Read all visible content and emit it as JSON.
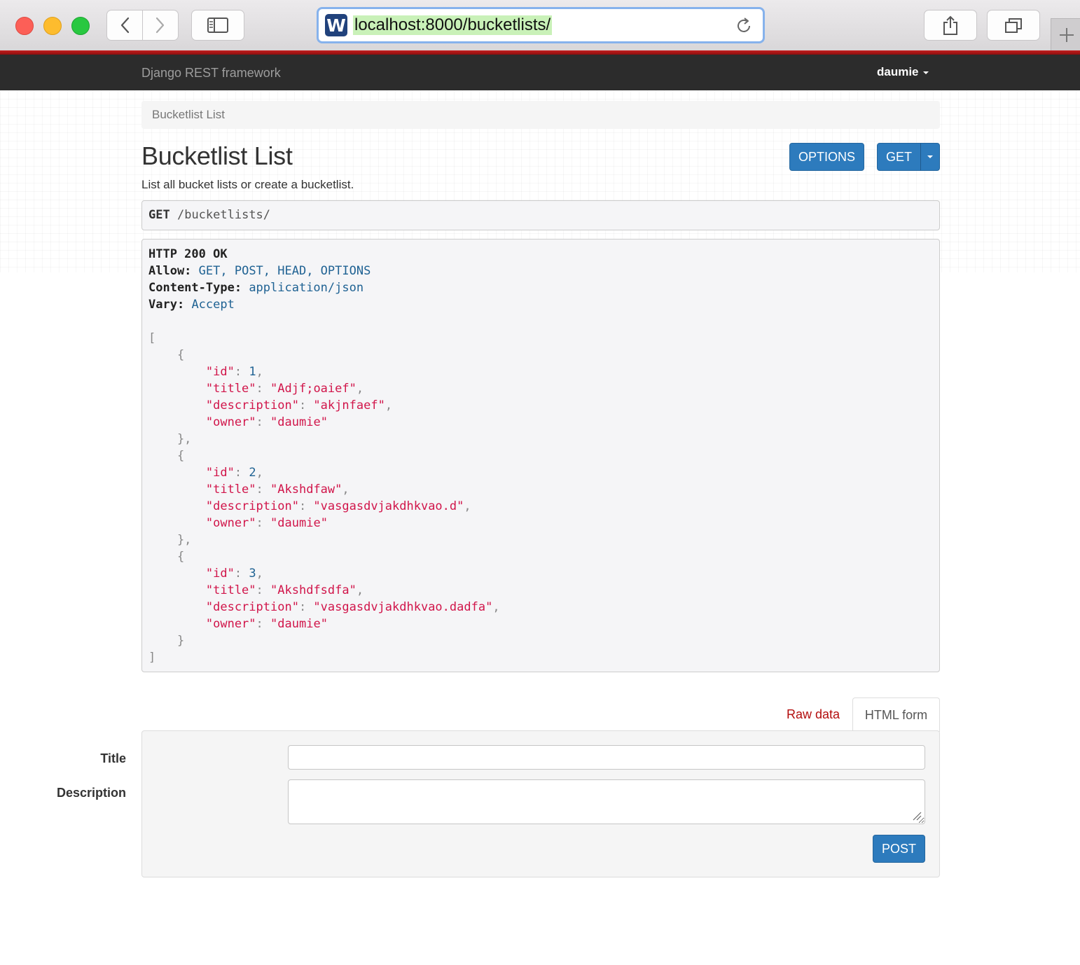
{
  "browser": {
    "url": "localhost:8000/bucketlists/",
    "favicon_letter": "W",
    "icons": [
      "back-icon",
      "forward-icon",
      "sidebar-icon",
      "reload-icon",
      "share-icon",
      "tabs-icon",
      "new-tab-icon"
    ]
  },
  "navbar": {
    "brand": "Django REST framework",
    "user": "daumie"
  },
  "breadcrumb": "Bucketlist List",
  "page": {
    "title": "Bucketlist List",
    "description": "List all bucket lists or create a bucketlist."
  },
  "buttons": {
    "options": "OPTIONS",
    "get": "GET",
    "post": "POST"
  },
  "request": {
    "method": "GET",
    "path": "/bucketlists/"
  },
  "response": {
    "status": "HTTP 200 OK",
    "headers": [
      {
        "name": "Allow:",
        "value": "GET, POST, HEAD, OPTIONS"
      },
      {
        "name": "Content-Type:",
        "value": "application/json"
      },
      {
        "name": "Vary:",
        "value": "Accept"
      }
    ],
    "body": [
      {
        "id": 1,
        "title": "Adjf;oaief",
        "description": "akjnfaef",
        "owner": "daumie"
      },
      {
        "id": 2,
        "title": "Akshdfaw",
        "description": "vasgasdvjakdhkvao.d",
        "owner": "daumie"
      },
      {
        "id": 3,
        "title": "Akshdfsdfa",
        "description": "vasgasdvjakdhkvao.dadfa",
        "owner": "daumie"
      }
    ]
  },
  "tabs": {
    "raw": "Raw data",
    "html": "HTML form"
  },
  "form": {
    "title_label": "Title",
    "description_label": "Description",
    "title_value": "",
    "description_value": ""
  },
  "colors": {
    "accent": "#2d7bbd",
    "navbar": "#2c2c2c",
    "json_string": "#d1154a",
    "header_value": "#1f6293"
  }
}
